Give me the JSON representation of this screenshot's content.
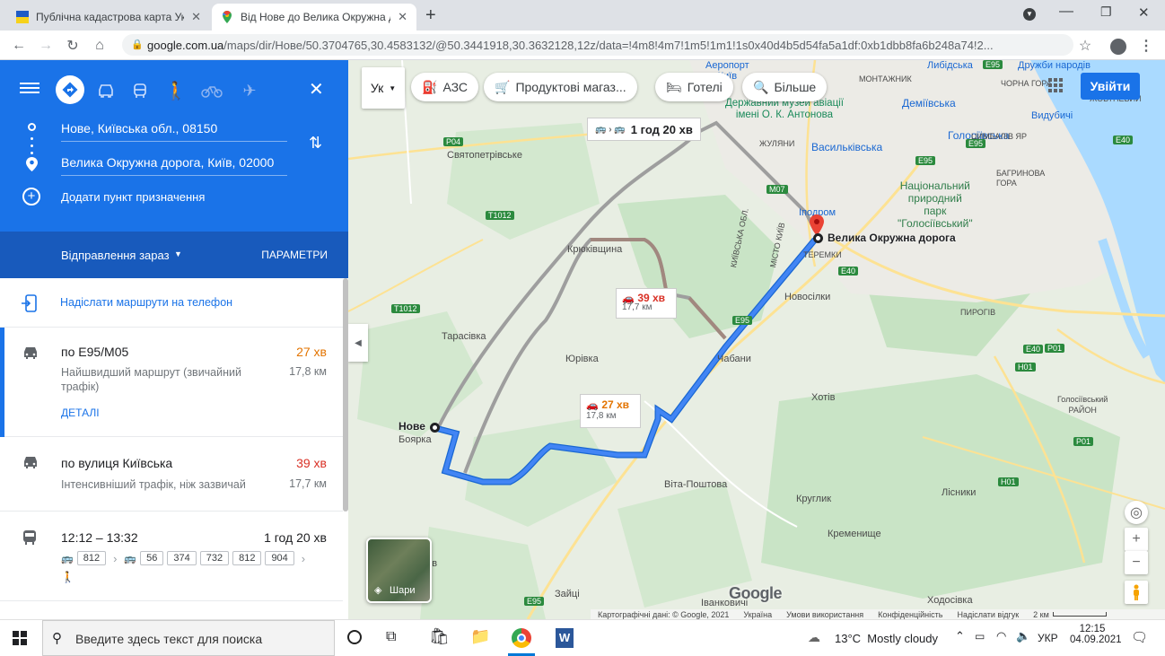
{
  "browser": {
    "tabs": [
      {
        "title": "Публічна кадастрова карта Укр"
      },
      {
        "title": "Від Нове до Велика Окружна до"
      }
    ],
    "url_host": "google.com.ua",
    "url_path": "/maps/dir/Нове/50.3704765,30.4583132/@50.3441918,30.3632128,12z/data=!4m8!4m7!1m5!1m1!1s0x40d4b5d54fa5a1df:0xb1dbb8fa6b248a74!2..."
  },
  "panel": {
    "origin": "Нове, Київська обл., 08150",
    "destination": "Велика Окружна дорога, Київ, 02000",
    "add_destination": "Додати пункт призначення",
    "depart_now": "Відправлення зараз",
    "options": "ПАРАМЕТРИ",
    "send_to_phone": "Надіслати маршрути на телефон",
    "routes": [
      {
        "name": "по E95/M05",
        "time": "27 хв",
        "desc": "Найшвидший маршрут (звичайний трафік)",
        "dist": "17,8 км",
        "details": "ДЕТАЛІ"
      },
      {
        "name": "по вулиця Київська",
        "time": "39 хв",
        "desc": "Інтенсивніший трафік, ніж зазвичай",
        "dist": "17,7 км"
      },
      {
        "name": "12:12 – 13:32",
        "time": "1 год 20 хв",
        "buses_a": [
          "812"
        ],
        "buses_b": [
          "56",
          "374",
          "732",
          "812",
          "904"
        ]
      }
    ]
  },
  "map": {
    "chips": {
      "lang": "Ук",
      "gas": "АЗС",
      "grocery": "Продуктові магаз...",
      "hotels": "Готелі",
      "more": "Більше"
    },
    "signin": "Увійти",
    "callouts": {
      "transit": "1 год 20 хв",
      "alt_time": "39 хв",
      "alt_dist": "17,7 км",
      "main_time": "27 хв",
      "main_dist": "17,8 км"
    },
    "labels": {
      "dest": "Велика Окружна дорога",
      "origin": "Нове",
      "boyarka": "Боярка",
      "svyatopetr": "Святопетрівське",
      "kryuk": "Крюківщина",
      "taras": "Тарасівка",
      "yuriv": "Юрівка",
      "chabany": "Чабани",
      "novosilky": "Новосілки",
      "khotiv": "Хотів",
      "vita": "Віта-Поштова",
      "kruhlyk": "Круглик",
      "kremen": "Кременище",
      "zaitsi": "Зайці",
      "ivankovychi": "Іванковичі",
      "khodosivka": "Ходосівка",
      "lisnyky": "Лісники",
      "pyrohiv": "ПИРОГІВ",
      "holos_rayon": "Голосіївський\nРАЙОН",
      "vasylkivska": "Васильківська",
      "holosiivska": "Голосіївська",
      "demiivska": "Деміївська",
      "lybidska": "Либідська",
      "druzhby": "Дружби народів",
      "vydubychi": "Видубичі",
      "ipodrom": "Іподром",
      "park": "Національний\nприродний\nпарк\n\"Голосіївський\"",
      "museum": "Державний музей авіації\nімені О. К. Антонова",
      "airport": "Аеропорт\nКиїв",
      "zhuliany": "ЖУЛЯНИ",
      "montazhnyk": "МОНТАЖНИК",
      "teremky": "ТЕРЕМКИ",
      "chorna_hora": "ЧОРНА ГОРА",
      "tsymbaliv": "ЦИМБАЛІВ ЯР",
      "baharynova": "БАГРИНОВА\nГОРА",
      "koshova": "ЖОВТНЕВИЙ",
      "kiev_obl": "КИЇВСЬКА ОБЛ.",
      "misto_kyiv": "МІСТО КИЇВ",
      "kiv": "ків"
    },
    "shields": [
      "P04",
      "T1012",
      "T1012",
      "M07",
      "E95",
      "E40",
      "E95",
      "E40",
      "E95",
      "E40",
      "P01",
      "H01",
      "H01",
      "P01",
      "E95",
      "E95"
    ],
    "layers": "Шари",
    "footer": {
      "data": "Картографічні дані: © Google, 2021",
      "country": "Україна",
      "terms": "Умови використання",
      "privacy": "Конфіденційність",
      "feedback": "Надіслати відгук",
      "scale": "2 км"
    },
    "logo": "Google"
  },
  "taskbar": {
    "search": "Введите здесь текст для поиска",
    "weather": "13°C  Mostly cloudy",
    "lang": "УКР",
    "time": "12:15",
    "date": "04.09.2021"
  },
  "colors": {
    "blue": "#1a73e8",
    "dark_blue": "#185abc",
    "route": "#4285f4",
    "orange": "#e37400",
    "red": "#d93025"
  }
}
